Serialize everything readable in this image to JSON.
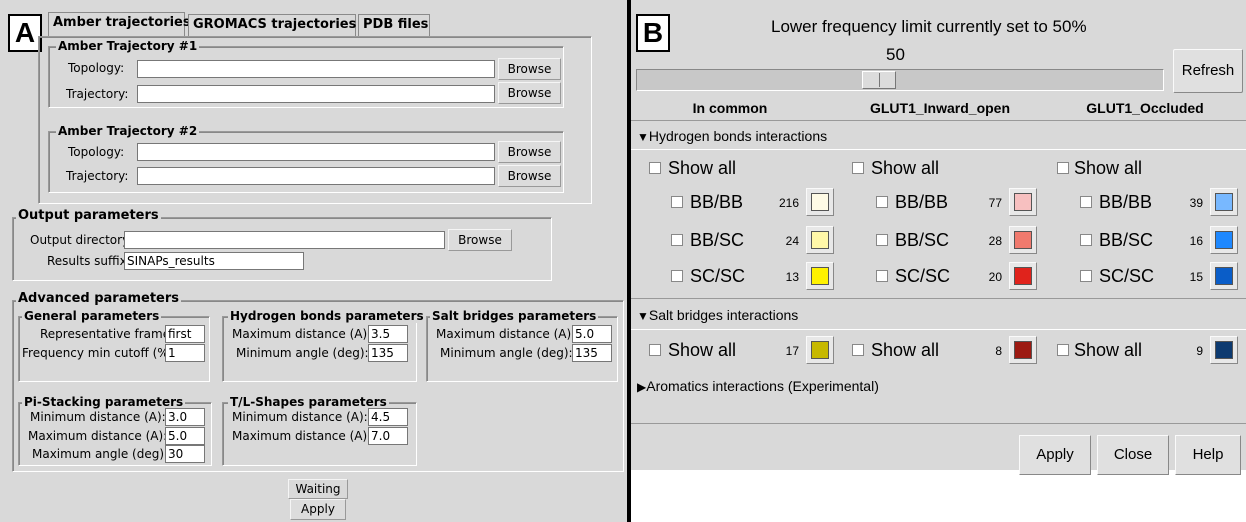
{
  "panelA": {
    "letter": "A",
    "tabs": [
      "Amber trajectories",
      "GROMACS trajectories",
      "PDB files"
    ],
    "traj1": {
      "title": "Amber Trajectory #1",
      "topology_label": "Topology:",
      "trajectory_label": "Trajectory:",
      "browse": "Browse"
    },
    "traj2": {
      "title": "Amber Trajectory #2",
      "topology_label": "Topology:",
      "trajectory_label": "Trajectory:",
      "browse": "Browse"
    },
    "output": {
      "title": "Output parameters",
      "dir_label": "Output directory:",
      "browse": "Browse",
      "suffix_label": "Results suffix:",
      "suffix_value": "SINAPs_results"
    },
    "advanced": {
      "title": "Advanced parameters",
      "general": {
        "title": "General parameters",
        "rep_label": "Representative frame:",
        "rep_value": "first",
        "freq_label": "Frequency min cutoff (%):",
        "freq_value": "1"
      },
      "hbond": {
        "title": "Hydrogen bonds parameters",
        "maxd_label": "Maximum distance (A):",
        "maxd_value": "3.5",
        "mina_label": "Minimum angle (deg):",
        "mina_value": "135"
      },
      "salt": {
        "title": "Salt bridges parameters",
        "maxd_label": "Maximum distance (A):",
        "maxd_value": "5.0",
        "mina_label": "Minimum angle (deg):",
        "mina_value": "135"
      },
      "pi": {
        "title": "Pi-Stacking parameters",
        "mind_label": "Minimum distance (A):",
        "mind_value": "3.0",
        "maxd_label": "Maximum distance (A):",
        "maxd_value": "5.0",
        "maxa_label": "Maximum angle (deg):",
        "maxa_value": "30"
      },
      "tl": {
        "title": "T/L-Shapes parameters",
        "mind_label": "Minimum distance (A):",
        "mind_value": "4.5",
        "maxd_label": "Maximum distance (A):",
        "maxd_value": "7.0"
      }
    },
    "status": "Waiting",
    "apply": "Apply"
  },
  "panelB": {
    "letter": "B",
    "freq_text": "Lower frequency limit currently set to 50%",
    "slider_value": "50",
    "slider_fraction": 0.5,
    "refresh": "Refresh",
    "columns": [
      "In common",
      "GLUT1_Inward_open",
      "GLUT1_Occluded"
    ],
    "hbond_section": "Hydrogen bonds interactions",
    "show_all": "Show all",
    "hbond_rows": [
      {
        "label": "BB/BB",
        "counts": [
          "216",
          "77",
          "39"
        ]
      },
      {
        "label": "BB/SC",
        "counts": [
          "24",
          "28",
          "16"
        ]
      },
      {
        "label": "SC/SC",
        "counts": [
          "13",
          "20",
          "15"
        ]
      }
    ],
    "hbond_colors": [
      [
        "#fffbe6",
        "#f7c0c0",
        "#78b8ff"
      ],
      [
        "#fff7a8",
        "#f07a6e",
        "#1e88ff"
      ],
      [
        "#fff200",
        "#e0231c",
        "#0a5dc8"
      ]
    ],
    "salt_section": "Salt bridges interactions",
    "salt_counts": [
      "17",
      "8",
      "9"
    ],
    "salt_colors": [
      "#c6b800",
      "#9c1a12",
      "#0d3a70"
    ],
    "arom_section": "Aromatics interactions (Experimental)",
    "buttons": {
      "apply": "Apply",
      "close": "Close",
      "help": "Help"
    }
  }
}
